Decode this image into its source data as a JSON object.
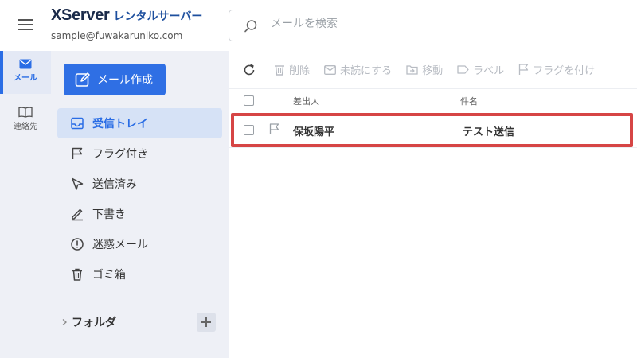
{
  "header": {
    "brand_name": "XServer",
    "brand_sub": "レンタルサーバー",
    "account_email": "sample@fuwakaruniko.com",
    "search_placeholder": "メールを検索"
  },
  "rail": {
    "items": [
      {
        "label": "メール",
        "icon": "mail-icon",
        "active": true
      },
      {
        "label": "連絡先",
        "icon": "book-icon",
        "active": false
      }
    ]
  },
  "sidebar": {
    "compose_label": "メール作成",
    "items": [
      {
        "label": "受信トレイ",
        "icon": "inbox-icon",
        "active": true
      },
      {
        "label": "フラグ付き",
        "icon": "flag-icon",
        "active": false
      },
      {
        "label": "送信済み",
        "icon": "send-icon",
        "active": false
      },
      {
        "label": "下書き",
        "icon": "pencil-icon",
        "active": false
      },
      {
        "label": "迷惑メール",
        "icon": "spam-icon",
        "active": false
      },
      {
        "label": "ゴミ箱",
        "icon": "trash-icon",
        "active": false
      }
    ],
    "folder_label": "フォルダ"
  },
  "toolbar": {
    "delete_label": "削除",
    "unread_label": "未読にする",
    "move_label": "移動",
    "label_label": "ラベル",
    "flag_label": "フラグを付け"
  },
  "list": {
    "col_from": "差出人",
    "col_subject": "件名",
    "rows": [
      {
        "from": "保坂陽平",
        "subject": "テスト送信"
      }
    ]
  },
  "colors": {
    "accent": "#2f6fe4",
    "sidebar_bg": "#eef0f6",
    "active_item_bg": "#d6e2f6",
    "highlight_border": "#d64545"
  }
}
